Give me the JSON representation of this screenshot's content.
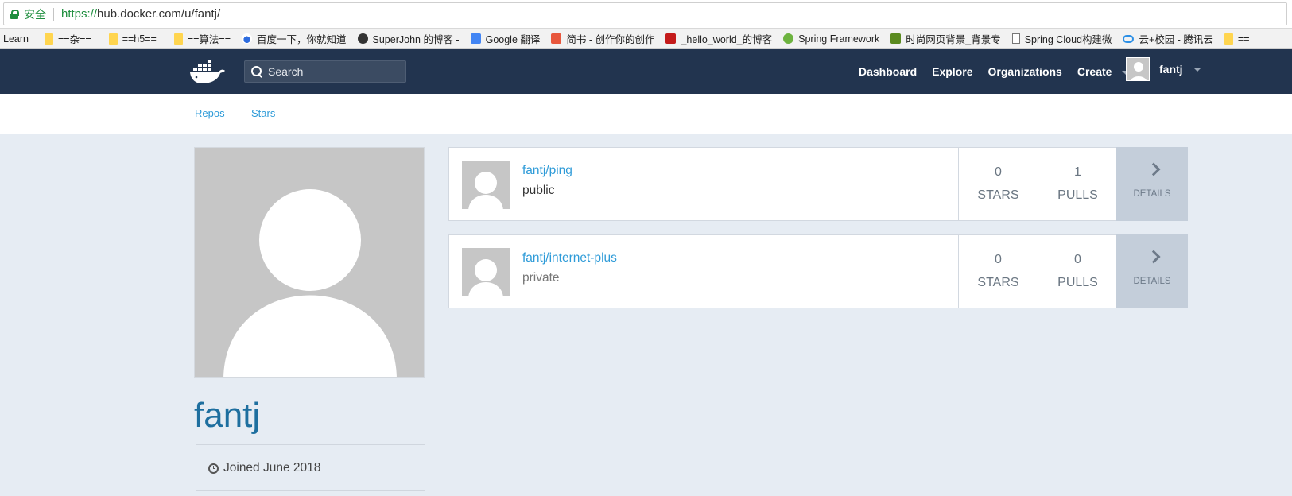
{
  "browser": {
    "secure_label": "安全",
    "url_scheme": "https://",
    "url_rest": "hub.docker.com/u/fantj/",
    "bookmarks": [
      {
        "label": "Learn",
        "icon": "none"
      },
      {
        "label": "==杂==",
        "icon": "folder-icon"
      },
      {
        "label": "==h5==",
        "icon": "folder-icon"
      },
      {
        "label": "==算法==",
        "icon": "folder-icon"
      },
      {
        "label": "百度一下，你就知道",
        "icon": "baidu-icon"
      },
      {
        "label": "SuperJohn 的博客 -",
        "icon": "github-icon"
      },
      {
        "label": "Google 翻译",
        "icon": "google-translate-icon"
      },
      {
        "label": "简书 - 创作你的创作",
        "icon": "jianshu-icon"
      },
      {
        "label": "_hello_world_的博客",
        "icon": "csdn-icon"
      },
      {
        "label": "Spring Framework",
        "icon": "spring-icon"
      },
      {
        "label": "时尚网页背景_背景专",
        "icon": "lan-icon"
      },
      {
        "label": "Spring Cloud构建微",
        "icon": "document-icon"
      },
      {
        "label": "云+校园 - 腾讯云",
        "icon": "cloud-icon"
      },
      {
        "label": "==",
        "icon": "folder-icon"
      }
    ]
  },
  "nav": {
    "search_placeholder": "Search",
    "links": [
      "Dashboard",
      "Explore",
      "Organizations",
      "Create"
    ],
    "username": "fantj"
  },
  "subnav": {
    "repos": "Repos",
    "stars": "Stars"
  },
  "profile": {
    "username": "fantj",
    "joined": "Joined June 2018"
  },
  "repos": [
    {
      "name": "fantj/ping",
      "visibility": "public",
      "stars": "0",
      "stars_label": "STARS",
      "pulls": "1",
      "pulls_label": "PULLS",
      "details_label": "DETAILS"
    },
    {
      "name": "fantj/internet-plus",
      "visibility": "private",
      "stars": "0",
      "stars_label": "STARS",
      "pulls": "0",
      "pulls_label": "PULLS",
      "details_label": "DETAILS"
    }
  ],
  "colors": {
    "nav_bg": "#22344f",
    "page_bg": "#e6ecf3",
    "link": "#2e9bd8",
    "username": "#1e6f9f",
    "details_bg": "#c4ceda"
  }
}
